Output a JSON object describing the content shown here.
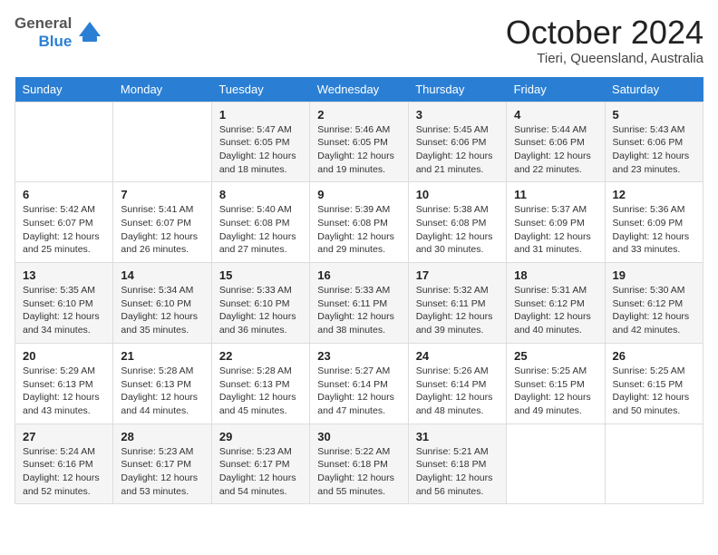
{
  "header": {
    "logo_line1": "General",
    "logo_line2": "Blue",
    "month": "October 2024",
    "location": "Tieri, Queensland, Australia"
  },
  "weekdays": [
    "Sunday",
    "Monday",
    "Tuesday",
    "Wednesday",
    "Thursday",
    "Friday",
    "Saturday"
  ],
  "weeks": [
    [
      {
        "day": "",
        "info": ""
      },
      {
        "day": "",
        "info": ""
      },
      {
        "day": "1",
        "info": "Sunrise: 5:47 AM\nSunset: 6:05 PM\nDaylight: 12 hours and 18 minutes."
      },
      {
        "day": "2",
        "info": "Sunrise: 5:46 AM\nSunset: 6:05 PM\nDaylight: 12 hours and 19 minutes."
      },
      {
        "day": "3",
        "info": "Sunrise: 5:45 AM\nSunset: 6:06 PM\nDaylight: 12 hours and 21 minutes."
      },
      {
        "day": "4",
        "info": "Sunrise: 5:44 AM\nSunset: 6:06 PM\nDaylight: 12 hours and 22 minutes."
      },
      {
        "day": "5",
        "info": "Sunrise: 5:43 AM\nSunset: 6:06 PM\nDaylight: 12 hours and 23 minutes."
      }
    ],
    [
      {
        "day": "6",
        "info": "Sunrise: 5:42 AM\nSunset: 6:07 PM\nDaylight: 12 hours and 25 minutes."
      },
      {
        "day": "7",
        "info": "Sunrise: 5:41 AM\nSunset: 6:07 PM\nDaylight: 12 hours and 26 minutes."
      },
      {
        "day": "8",
        "info": "Sunrise: 5:40 AM\nSunset: 6:08 PM\nDaylight: 12 hours and 27 minutes."
      },
      {
        "day": "9",
        "info": "Sunrise: 5:39 AM\nSunset: 6:08 PM\nDaylight: 12 hours and 29 minutes."
      },
      {
        "day": "10",
        "info": "Sunrise: 5:38 AM\nSunset: 6:08 PM\nDaylight: 12 hours and 30 minutes."
      },
      {
        "day": "11",
        "info": "Sunrise: 5:37 AM\nSunset: 6:09 PM\nDaylight: 12 hours and 31 minutes."
      },
      {
        "day": "12",
        "info": "Sunrise: 5:36 AM\nSunset: 6:09 PM\nDaylight: 12 hours and 33 minutes."
      }
    ],
    [
      {
        "day": "13",
        "info": "Sunrise: 5:35 AM\nSunset: 6:10 PM\nDaylight: 12 hours and 34 minutes."
      },
      {
        "day": "14",
        "info": "Sunrise: 5:34 AM\nSunset: 6:10 PM\nDaylight: 12 hours and 35 minutes."
      },
      {
        "day": "15",
        "info": "Sunrise: 5:33 AM\nSunset: 6:10 PM\nDaylight: 12 hours and 36 minutes."
      },
      {
        "day": "16",
        "info": "Sunrise: 5:33 AM\nSunset: 6:11 PM\nDaylight: 12 hours and 38 minutes."
      },
      {
        "day": "17",
        "info": "Sunrise: 5:32 AM\nSunset: 6:11 PM\nDaylight: 12 hours and 39 minutes."
      },
      {
        "day": "18",
        "info": "Sunrise: 5:31 AM\nSunset: 6:12 PM\nDaylight: 12 hours and 40 minutes."
      },
      {
        "day": "19",
        "info": "Sunrise: 5:30 AM\nSunset: 6:12 PM\nDaylight: 12 hours and 42 minutes."
      }
    ],
    [
      {
        "day": "20",
        "info": "Sunrise: 5:29 AM\nSunset: 6:13 PM\nDaylight: 12 hours and 43 minutes."
      },
      {
        "day": "21",
        "info": "Sunrise: 5:28 AM\nSunset: 6:13 PM\nDaylight: 12 hours and 44 minutes."
      },
      {
        "day": "22",
        "info": "Sunrise: 5:28 AM\nSunset: 6:13 PM\nDaylight: 12 hours and 45 minutes."
      },
      {
        "day": "23",
        "info": "Sunrise: 5:27 AM\nSunset: 6:14 PM\nDaylight: 12 hours and 47 minutes."
      },
      {
        "day": "24",
        "info": "Sunrise: 5:26 AM\nSunset: 6:14 PM\nDaylight: 12 hours and 48 minutes."
      },
      {
        "day": "25",
        "info": "Sunrise: 5:25 AM\nSunset: 6:15 PM\nDaylight: 12 hours and 49 minutes."
      },
      {
        "day": "26",
        "info": "Sunrise: 5:25 AM\nSunset: 6:15 PM\nDaylight: 12 hours and 50 minutes."
      }
    ],
    [
      {
        "day": "27",
        "info": "Sunrise: 5:24 AM\nSunset: 6:16 PM\nDaylight: 12 hours and 52 minutes."
      },
      {
        "day": "28",
        "info": "Sunrise: 5:23 AM\nSunset: 6:17 PM\nDaylight: 12 hours and 53 minutes."
      },
      {
        "day": "29",
        "info": "Sunrise: 5:23 AM\nSunset: 6:17 PM\nDaylight: 12 hours and 54 minutes."
      },
      {
        "day": "30",
        "info": "Sunrise: 5:22 AM\nSunset: 6:18 PM\nDaylight: 12 hours and 55 minutes."
      },
      {
        "day": "31",
        "info": "Sunrise: 5:21 AM\nSunset: 6:18 PM\nDaylight: 12 hours and 56 minutes."
      },
      {
        "day": "",
        "info": ""
      },
      {
        "day": "",
        "info": ""
      }
    ]
  ]
}
